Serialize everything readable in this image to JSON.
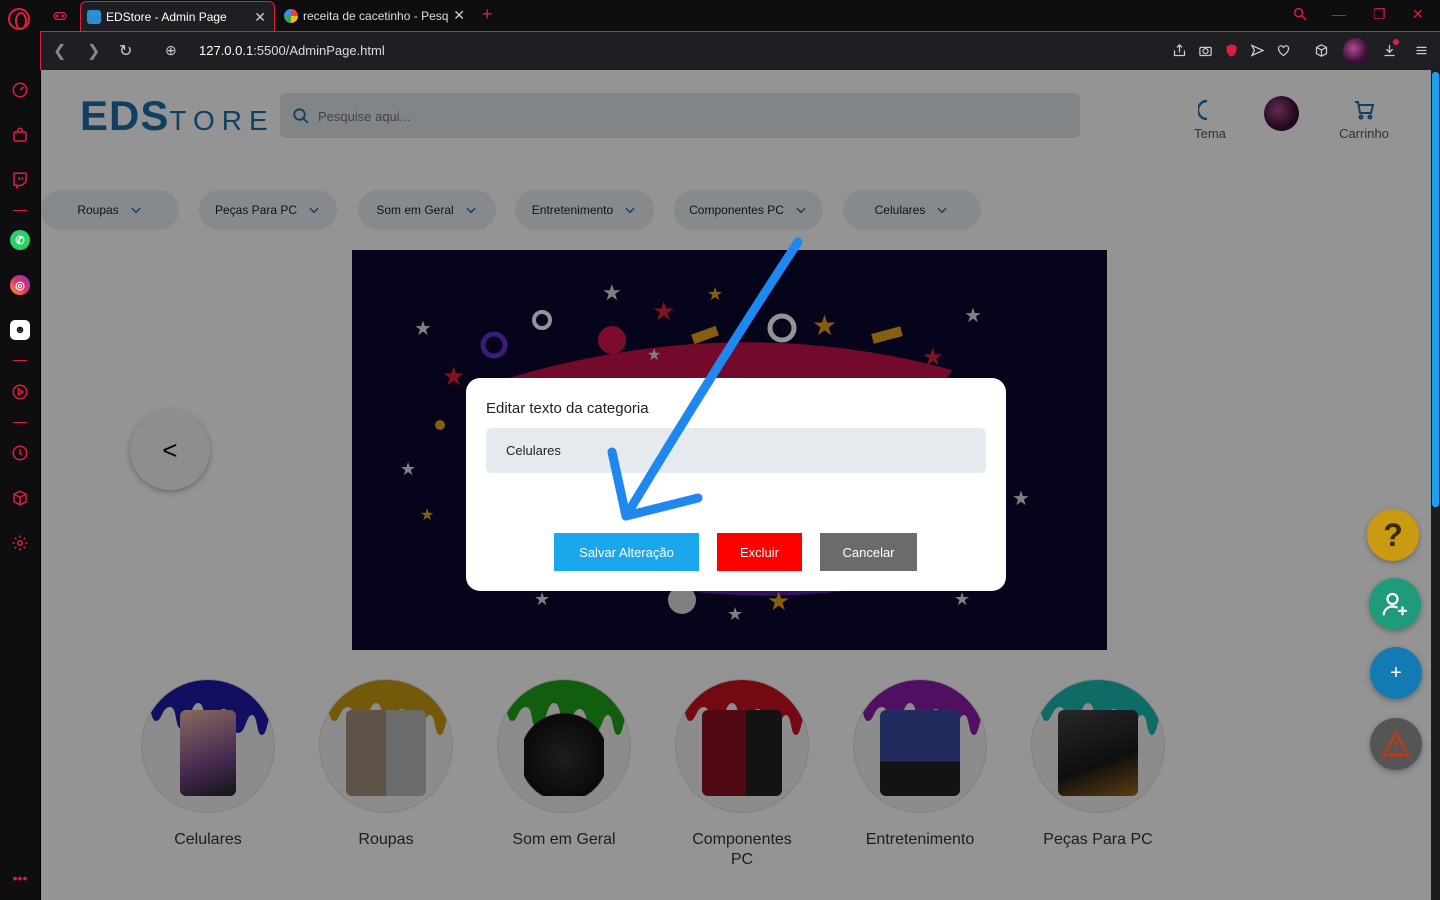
{
  "browser": {
    "tabs": [
      {
        "title": "EDStore - Admin Page",
        "active": true
      },
      {
        "title": "receita de cacetinho - Pesq",
        "active": false
      }
    ],
    "url_host": "127.0.0.1",
    "url_rest": ":5500/AdminPage.html"
  },
  "header": {
    "logo_main": "EDS",
    "logo_sub": "TORE",
    "search_placeholder": "Pesquise aqui...",
    "theme_label": "Tema",
    "cart_label": "Carrinho"
  },
  "categories": [
    "Roupas",
    "Peças Para PC",
    "Som em Geral",
    "Entretenimento",
    "Componentes PC",
    "Celulares"
  ],
  "carousel_prev": "<",
  "circle_categories": [
    "Celulares",
    "Roupas",
    "Som em Geral",
    "Componentes PC",
    "Entretenimento",
    "Peças Para PC"
  ],
  "fabs": [
    "help-icon",
    "add-user-icon",
    "plus-icon",
    "warning-icon"
  ],
  "fab_plus_label": "+",
  "modal": {
    "title": "Editar texto da categoria",
    "input_value": "Celulares",
    "save_label": "Salvar Alteração",
    "delete_label": "Excluir",
    "cancel_label": "Cancelar"
  },
  "colors": {
    "brand": "#1b6fa8",
    "save": "#1aa7ec",
    "delete": "#ff0000",
    "cancel": "#6b6b6b",
    "browser_accent": "#e01e3c",
    "annotation_arrow": "#1e88f0"
  }
}
